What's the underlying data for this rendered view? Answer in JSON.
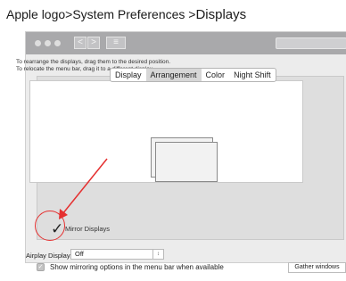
{
  "breadcrumb": {
    "prefix": "Apple logo>System Preferences >",
    "current": "Displays"
  },
  "titlebar": {
    "back": "<",
    "forward": ">",
    "grid": "≡"
  },
  "tabs": [
    {
      "label": "Display",
      "active": false
    },
    {
      "label": "Arrangement",
      "active": true
    },
    {
      "label": "Color",
      "active": false
    },
    {
      "label": "Night Shift",
      "active": false
    }
  ],
  "instructions": {
    "line1": "To rearrange the displays, drag them to the desired position.",
    "line2": "To relocate the menu bar, drag it to a different display."
  },
  "mirror": {
    "label": "Mirror Displays",
    "checked": true,
    "checkmark": "✓"
  },
  "airplay": {
    "label": "Airplay Displays :",
    "value": "Off",
    "stepper": "↕"
  },
  "show_mirroring": {
    "label": "Show mirroring options in the menu bar when available",
    "checked": true,
    "checkmark": "✓"
  },
  "gather_button": "Gather windows",
  "colors": {
    "annotation": "#e53030",
    "titlebar": "#a9a9ab",
    "active_tab": "#d7d7d7"
  },
  "icons": [
    "window-dot",
    "back-arrow",
    "forward-arrow",
    "grid-icon",
    "checkmark",
    "annotation-arrow"
  ]
}
